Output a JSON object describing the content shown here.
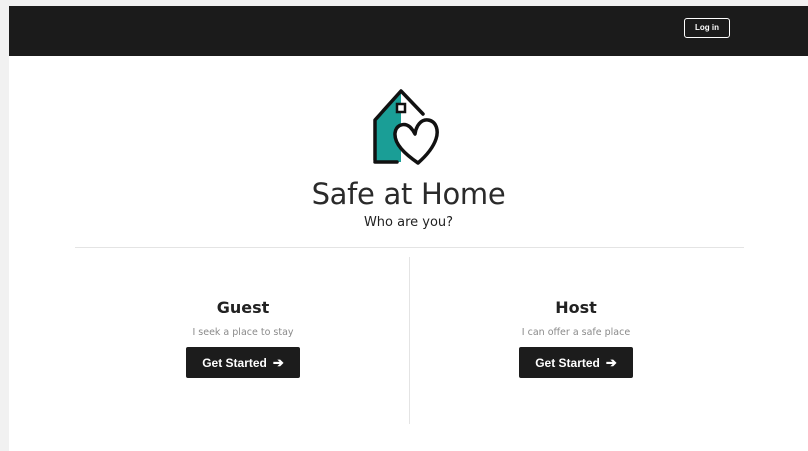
{
  "header": {
    "login_label": "Log in"
  },
  "brand": {
    "title": "Safe at Home",
    "logo_icon": "house-heart-icon",
    "logo_color": "#1a9e96"
  },
  "main": {
    "prompt": "Who are you?",
    "options": [
      {
        "title": "Guest",
        "description": "I seek a place to stay",
        "button_label": "Get Started",
        "button_icon": "arrow-right-icon"
      },
      {
        "title": "Host",
        "description": "I can offer a safe place",
        "button_label": "Get Started",
        "button_icon": "arrow-right-icon"
      }
    ]
  },
  "colors": {
    "topbar": "#1b1b1b",
    "button": "#1c1c1c",
    "accent": "#1a9e96"
  }
}
